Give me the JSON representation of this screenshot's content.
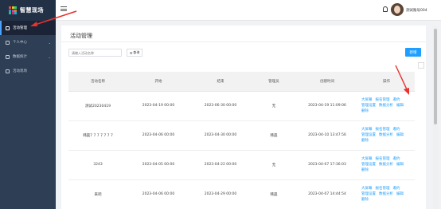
{
  "brand": {
    "name": "智慧现场"
  },
  "sidebar": {
    "items": [
      {
        "label": "活动管理",
        "active": true
      },
      {
        "label": "个人中心",
        "arrow": "⌄"
      },
      {
        "label": "数据统计",
        "arrow": "⌄"
      },
      {
        "label": "活动现场"
      }
    ]
  },
  "header": {
    "username": "测试账号004"
  },
  "main": {
    "title": "活动管理",
    "search_placeholder": "请输入活动名称",
    "query_label": "查询",
    "add_label": "新增"
  },
  "table": {
    "columns": [
      "活动名称",
      "开始",
      "结束",
      "管理员",
      "创建时间",
      "操作"
    ],
    "rows": [
      {
        "name": "测试20230419",
        "start": "2023-04-19 00:00",
        "end": "2023-06-30 00:00",
        "admin": "无",
        "created": "2023-04-19 11:09:06"
      },
      {
        "name": "韩晨7 7 7 7 7 7 7",
        "start": "2023-04-06 00:00",
        "end": "2023-04-30 00:00",
        "admin": "韩晨",
        "created": "2023-04-10 13:47:56"
      },
      {
        "name": "3243",
        "start": "2023-04-05 00:00",
        "end": "2023-04-22 00:00",
        "admin": "无",
        "created": "2023-04-07 17:36:03"
      },
      {
        "name": "来吧",
        "start": "2023-04-06 00:00",
        "end": "2023-04-29 00:00",
        "admin": "韩晨",
        "created": "2023-04-07 14:44:54"
      }
    ],
    "ops": {
      "big_screen": "大屏幕",
      "signup": "报名管理",
      "invite": "邀约",
      "manage_settings": "管理设置",
      "analysis": "数据分析",
      "edit": "编辑",
      "delete": "删除"
    }
  },
  "colors": {
    "sidebar": "#2e3e55",
    "accent": "#1e9fff",
    "annotation": "#e8322d"
  }
}
